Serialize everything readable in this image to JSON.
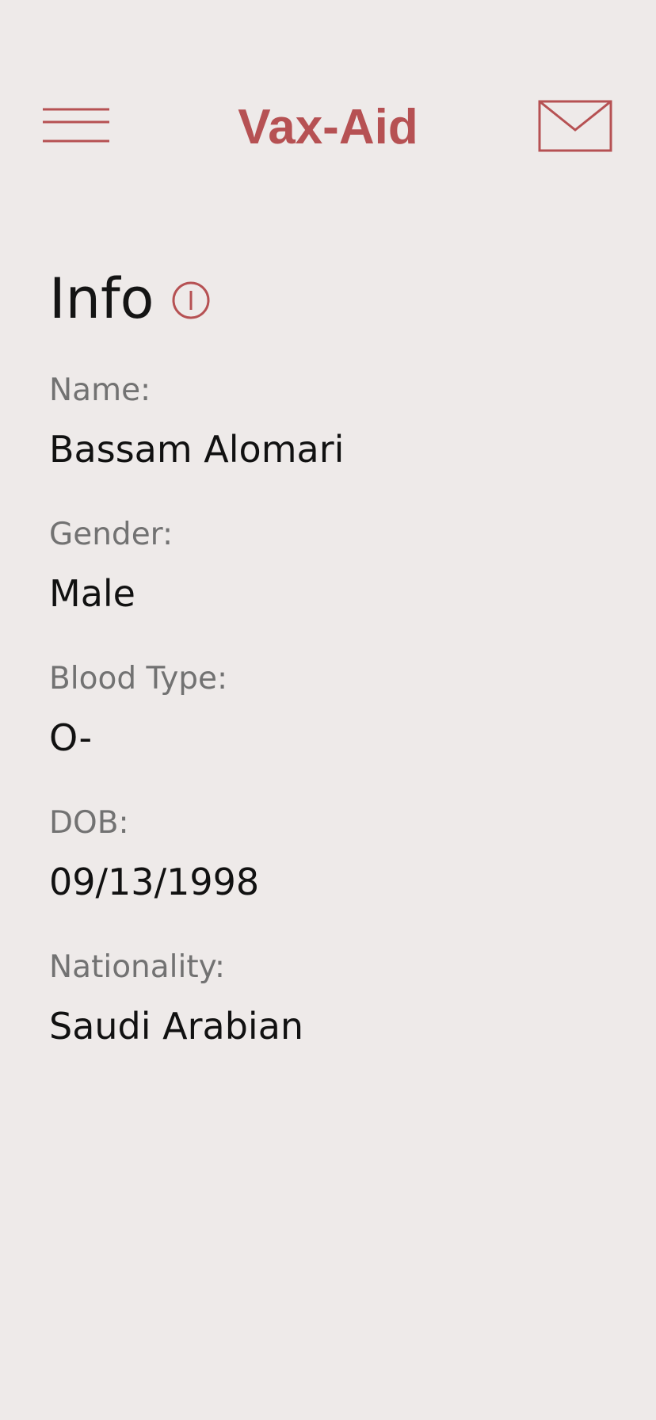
{
  "header": {
    "menu_icon": "hamburger-menu-icon",
    "title": "Vax-Aid",
    "mail_icon": "envelope-icon"
  },
  "colors": {
    "accent": "#b65153",
    "background": "#eeeae9",
    "label": "#727272",
    "value": "#111111"
  },
  "info": {
    "title": "Info",
    "title_icon": "info-icon",
    "fields": [
      {
        "label": "Name:",
        "value": "Bassam Alomari"
      },
      {
        "label": "Gender:",
        "value": "Male"
      },
      {
        "label": "Blood Type:",
        "value": "O-"
      },
      {
        "label": "DOB:",
        "value": "09/13/1998"
      },
      {
        "label": "Nationality:",
        "value": "Saudi Arabian"
      }
    ]
  }
}
